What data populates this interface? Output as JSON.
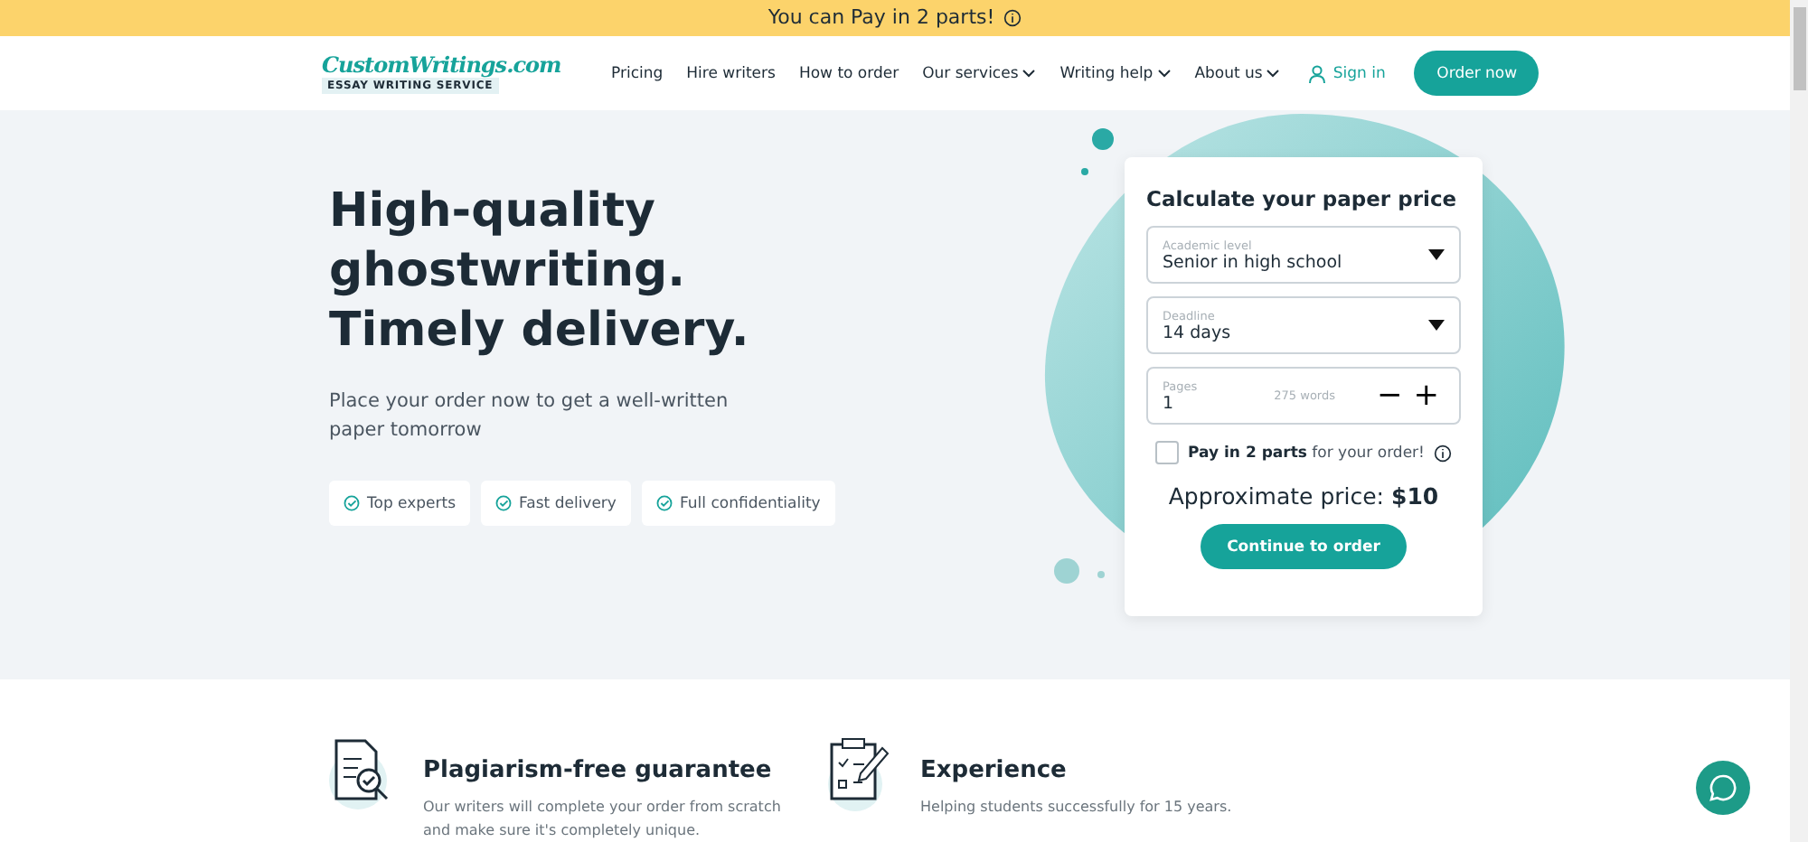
{
  "banner": {
    "text": "You can Pay in 2 parts!"
  },
  "header": {
    "logo": {
      "name": "CustomWritings.com",
      "tagline": "ESSAY WRITING SERVICE"
    },
    "nav": [
      {
        "label": "Pricing",
        "dropdown": false
      },
      {
        "label": "Hire writers",
        "dropdown": false
      },
      {
        "label": "How to order",
        "dropdown": false
      },
      {
        "label": "Our services",
        "dropdown": true
      },
      {
        "label": "Writing help",
        "dropdown": true
      },
      {
        "label": "About us",
        "dropdown": true
      }
    ],
    "sign_in": "Sign in",
    "order_button": "Order now"
  },
  "hero": {
    "title": "High-quality ghostwriting. Timely delivery.",
    "subtitle": "Place your order now to get a well-written paper tomorrow",
    "features": [
      "Top experts",
      "Fast delivery",
      "Full confidentiality"
    ]
  },
  "calculator": {
    "title": "Calculate your paper price",
    "academic_level": {
      "label": "Academic level",
      "value": "Senior in high school"
    },
    "deadline": {
      "label": "Deadline",
      "value": "14 days"
    },
    "pages": {
      "label": "Pages",
      "value": "1",
      "words": "275 words",
      "minus": "−",
      "plus": "+"
    },
    "pay_in_parts": {
      "checked": false,
      "text": "**Pay in 2 parts** for your order!"
    },
    "price_label": "Approximate price:",
    "price": "$10",
    "button": "Continue to order"
  },
  "benefits": [
    {
      "kind": "document",
      "title": "Plagiarism-free guarantee",
      "text": "Our writers will complete your order from scratch and make sure it's completely unique."
    },
    {
      "kind": "clipboard",
      "title": "Experience",
      "text": "Helping students successfully for 15 years."
    }
  ]
}
